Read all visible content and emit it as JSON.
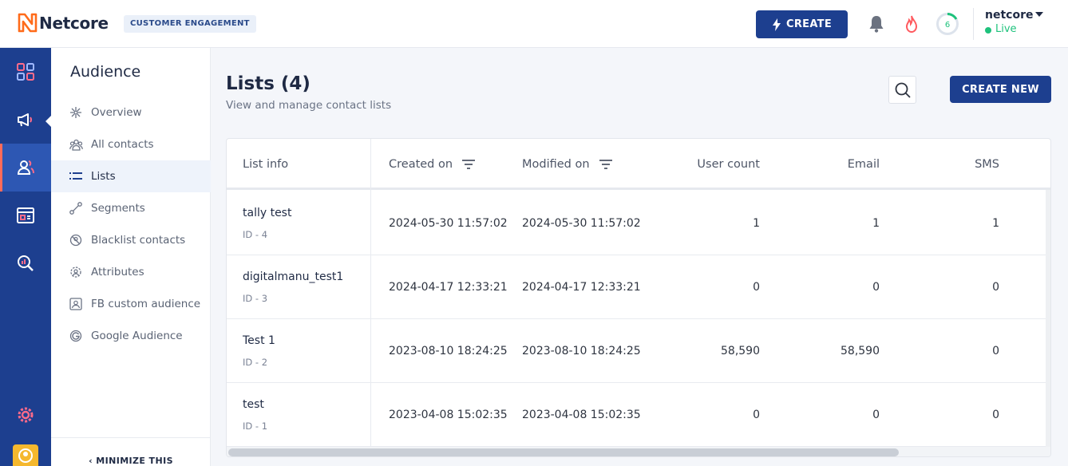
{
  "header": {
    "logo_text": "Netcore",
    "product_badge": "CUSTOMER ENGAGEMENT",
    "create_label": "CREATE",
    "notification_ring_count": "6",
    "user_name": "netcore",
    "status": "Live"
  },
  "colors": {
    "brand_navy": "#1d3f8f",
    "accent_orange": "#ff6b1a",
    "live_green": "#1ec27c"
  },
  "rail": {
    "icons": [
      "dashboard-icon",
      "megaphone-icon",
      "audience-icon",
      "content-icon",
      "analytics-icon",
      "settings-icon",
      "profile-icon"
    ],
    "active": "audience-icon"
  },
  "subnav": {
    "title": "Audience",
    "items": [
      {
        "label": "Overview",
        "icon": "overview-icon"
      },
      {
        "label": "All contacts",
        "icon": "contacts-icon"
      },
      {
        "label": "Lists",
        "icon": "list-icon"
      },
      {
        "label": "Segments",
        "icon": "segments-icon"
      },
      {
        "label": "Blacklist contacts",
        "icon": "blacklist-icon"
      },
      {
        "label": "Attributes",
        "icon": "attributes-icon"
      },
      {
        "label": "FB custom audience",
        "icon": "fb-audience-icon"
      },
      {
        "label": "Google Audience",
        "icon": "google-icon"
      }
    ],
    "active_item": "Lists",
    "minimize_label": "MINIMIZE THIS"
  },
  "main": {
    "title": "Lists (4)",
    "subtitle": "View and manage contact lists",
    "create_new_label": "CREATE NEW"
  },
  "table": {
    "columns": [
      "List info",
      "Created on",
      "Modified on",
      "User count",
      "Email",
      "SMS"
    ],
    "rows": [
      {
        "name": "tally test",
        "id": "ID - 4",
        "created": "2024-05-30 11:57:02",
        "modified": "2024-05-30 11:57:02",
        "users": "1",
        "email": "1",
        "sms": "1"
      },
      {
        "name": "digitalmanu_test1",
        "id": "ID - 3",
        "created": "2024-04-17 12:33:21",
        "modified": "2024-04-17 12:33:21",
        "users": "0",
        "email": "0",
        "sms": "0"
      },
      {
        "name": "Test 1",
        "id": "ID - 2",
        "created": "2023-08-10 18:24:25",
        "modified": "2023-08-10 18:24:25",
        "users": "58,590",
        "email": "58,590",
        "sms": "0"
      },
      {
        "name": "test",
        "id": "ID - 1",
        "created": "2023-04-08 15:02:35",
        "modified": "2023-04-08 15:02:35",
        "users": "0",
        "email": "0",
        "sms": "0"
      }
    ]
  }
}
